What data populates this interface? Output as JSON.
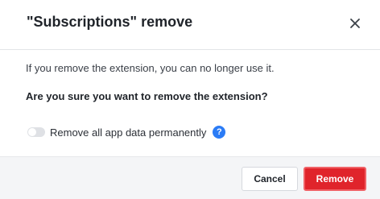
{
  "dialog": {
    "title": "\"Subscriptions\" remove",
    "message": "If you remove the extension, you can no longer use it.",
    "question": "Are you sure you want to remove the extension?",
    "toggle": {
      "label": "Remove all app data permanently",
      "checked": false
    },
    "help_icon": "question-circle-icon",
    "help_glyph": "?",
    "close_icon": "close-icon",
    "buttons": {
      "cancel": "Cancel",
      "remove": "Remove"
    },
    "colors": {
      "danger": "#e0242b",
      "help": "#2b7cf6",
      "footer_bg": "#f4f5f7"
    }
  }
}
